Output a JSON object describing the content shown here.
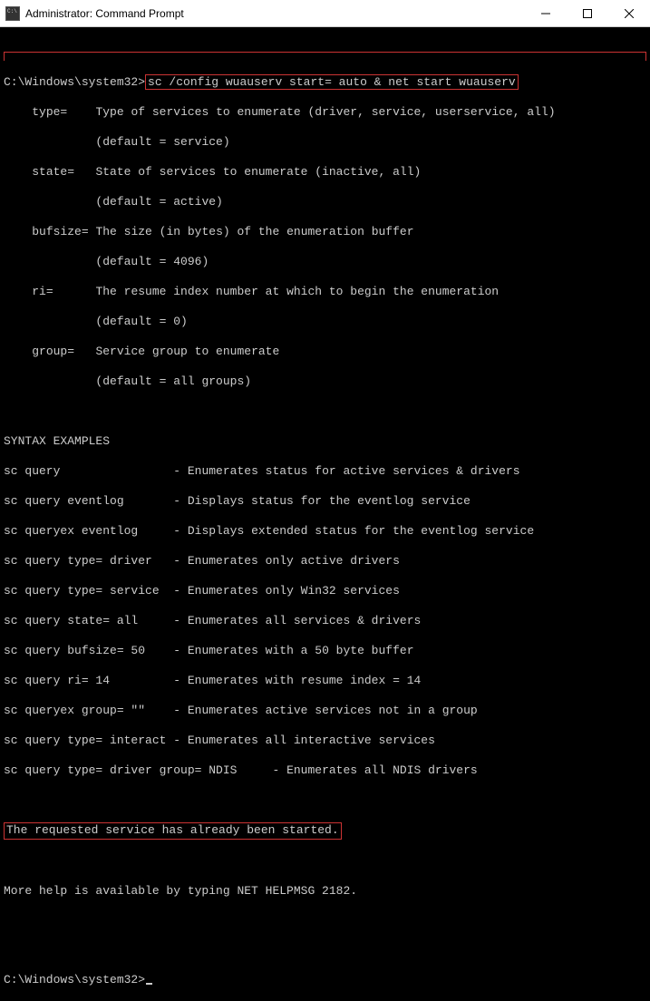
{
  "title_bar": {
    "title": "Administrator: Command Prompt"
  },
  "prompt": {
    "path": "C:\\Windows\\system32>",
    "command": "sc /config wuauserv start= auto & net start wuauserv"
  },
  "params": {
    "type": {
      "name": "type=",
      "desc": "Type of services to enumerate (driver, service, userservice, all)",
      "default": "(default = service)"
    },
    "state": {
      "name": "state=",
      "desc": "State of services to enumerate (inactive, all)",
      "default": "(default = active)"
    },
    "bufsize": {
      "name": "bufsize=",
      "desc": "The size (in bytes) of the enumeration buffer",
      "default": "(default = 4096)"
    },
    "ri": {
      "name": "ri=",
      "desc": "The resume index number at which to begin the enumeration",
      "default": "(default = 0)"
    },
    "group": {
      "name": "group=",
      "desc": "Service group to enumerate",
      "default": "(default = all groups)"
    }
  },
  "syntax_header": "SYNTAX EXAMPLES",
  "examples": [
    {
      "cmd": "sc query",
      "desc": "- Enumerates status for active services & drivers"
    },
    {
      "cmd": "sc query eventlog",
      "desc": "- Displays status for the eventlog service"
    },
    {
      "cmd": "sc queryex eventlog",
      "desc": "- Displays extended status for the eventlog service"
    },
    {
      "cmd": "sc query type= driver",
      "desc": "- Enumerates only active drivers"
    },
    {
      "cmd": "sc query type= service",
      "desc": "- Enumerates only Win32 services"
    },
    {
      "cmd": "sc query state= all",
      "desc": "- Enumerates all services & drivers"
    },
    {
      "cmd": "sc query bufsize= 50",
      "desc": "- Enumerates with a 50 byte buffer"
    },
    {
      "cmd": "sc query ri= 14",
      "desc": "- Enumerates with resume index = 14"
    },
    {
      "cmd": "sc queryex group= \"\"",
      "desc": "- Enumerates active services not in a group"
    },
    {
      "cmd": "sc query type= interact",
      "desc": "- Enumerates all interactive services"
    },
    {
      "cmd": "sc query type= driver group= NDIS",
      "desc": "- Enumerates all NDIS drivers"
    }
  ],
  "result": "The requested service has already been started.",
  "help": "More help is available by typing NET HELPMSG 2182.",
  "prompt2": "C:\\Windows\\system32>"
}
